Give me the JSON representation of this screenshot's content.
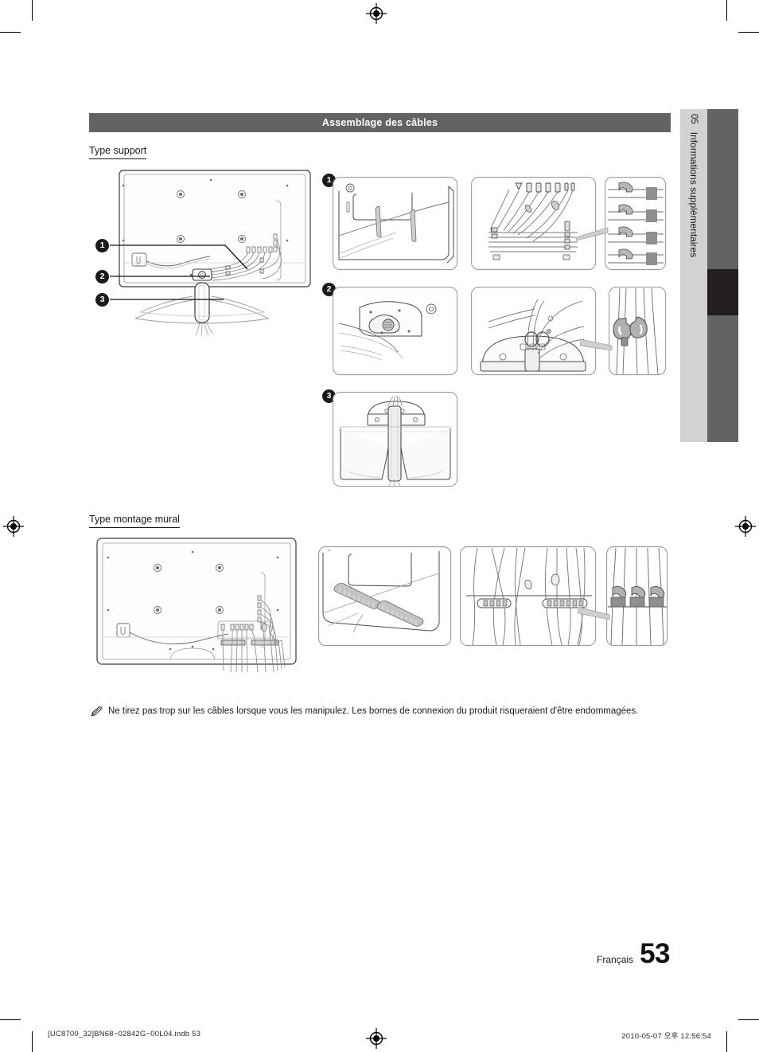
{
  "header": {
    "title": "Assemblage des câbles"
  },
  "chapter_tab": {
    "number": "05",
    "label": "Informations supplémentaires"
  },
  "sections": [
    {
      "id": "stand",
      "label": "Type support"
    },
    {
      "id": "wall",
      "label": "Type montage mural"
    }
  ],
  "callouts": {
    "one": "1",
    "two": "2",
    "three": "3"
  },
  "note": {
    "icon": "pencil-note-icon",
    "text": "Ne tirez pas trop sur les câbles lorsque vous les manipulez. Les bornes de connexion du produit risqueraient d'être endommagées."
  },
  "figures": {
    "stand_overview": "tv-back-with-stand-cable-routing-diagram",
    "step1_left": "tv-rear-lower-corner-detail",
    "step1_mid": "cables-into-stand-guide-detail",
    "step1_right": "cable-clip-closeup",
    "step2_left": "stand-neck-screw-detail",
    "step2_mid": "cable-holder-on-stand-base",
    "step2_right": "cable-holder-closeup",
    "step3": "cables-routed-through-stand-column",
    "wall_overview": "tv-back-wall-mount-cable-routing-diagram",
    "wall_left": "tv-rear-cable-holders-detail",
    "wall_mid": "cables-through-holders-detail",
    "wall_right": "cable-holder-closeup-wall"
  },
  "page_footer": {
    "language": "Français",
    "page_number": "53",
    "source_file": "[UC8700_32]BN68−02842G−00L04.indb   53",
    "timestamp": "2010-05-07   오후 12:56:54"
  }
}
